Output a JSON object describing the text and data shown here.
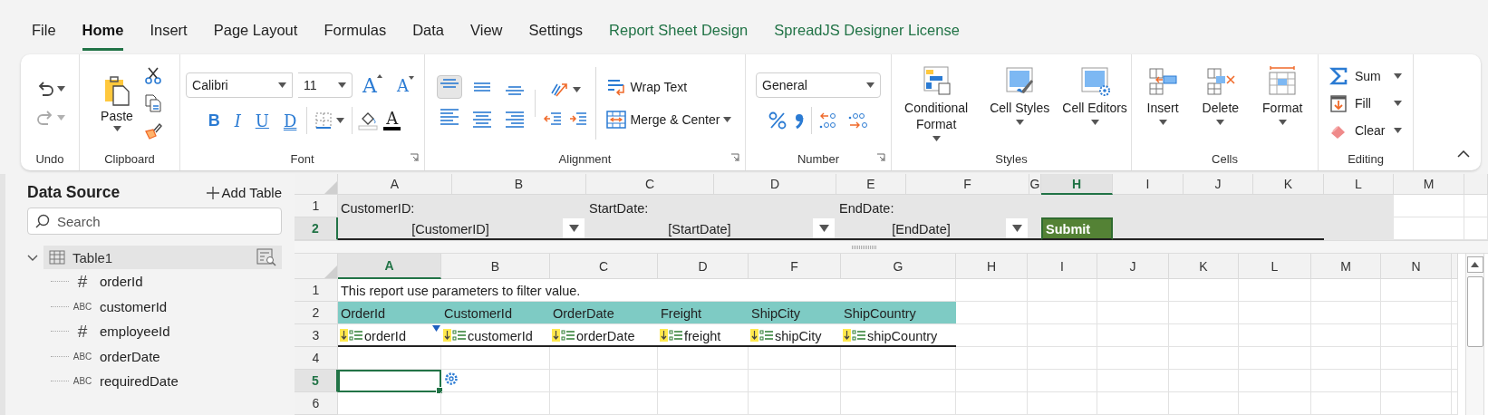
{
  "menu": [
    {
      "label": "File",
      "selected": false,
      "kind": "tab"
    },
    {
      "label": "Home",
      "selected": true,
      "kind": "tab"
    },
    {
      "label": "Insert",
      "selected": false,
      "kind": "tab"
    },
    {
      "label": "Page Layout",
      "selected": false,
      "kind": "tab"
    },
    {
      "label": "Formulas",
      "selected": false,
      "kind": "tab"
    },
    {
      "label": "Data",
      "selected": false,
      "kind": "tab"
    },
    {
      "label": "View",
      "selected": false,
      "kind": "tab"
    },
    {
      "label": "Settings",
      "selected": false,
      "kind": "tab"
    },
    {
      "label": "Report Sheet Design",
      "selected": false,
      "kind": "link"
    },
    {
      "label": "SpreadJS Designer License",
      "selected": false,
      "kind": "link"
    }
  ],
  "ribbon": {
    "undo": {
      "label": "Undo",
      "buttons": [
        {
          "disabled": false
        },
        {
          "disabled": true
        }
      ]
    },
    "clipboard": {
      "label": "Clipboard",
      "paste": "Paste"
    },
    "font": {
      "label": "Font",
      "name": "Calibri",
      "size": "11",
      "grow": "A",
      "shrink": "A",
      "styles": [
        "B",
        "I",
        "U",
        "D"
      ],
      "color_glyph": "A"
    },
    "alignment": {
      "label": "Alignment",
      "align": [
        {
          "selected": true
        },
        {
          "selected": false
        },
        {
          "selected": false
        },
        {
          "selected": false
        },
        {
          "selected": false
        },
        {
          "selected": false
        }
      ],
      "wrap": "Wrap Text",
      "merge": "Merge & Center"
    },
    "number": {
      "label": "Number",
      "format": "General"
    },
    "styles": {
      "label": "Styles",
      "buttons": [
        "Conditional Format",
        "Cell Styles",
        "Cell Editors"
      ]
    },
    "cells": {
      "label": "Cells",
      "buttons": [
        "Insert",
        "Delete",
        "Format"
      ]
    },
    "editing": {
      "label": "Editing",
      "buttons": [
        "Sum",
        "Fill",
        "Clear"
      ]
    }
  },
  "sidebar": {
    "title": "Data Source",
    "add_button": "Add Table",
    "search": {
      "placeholder": "Search"
    },
    "tree": [
      {
        "label": "Table1",
        "expanded": true,
        "selected": true,
        "children": [
          {
            "label": "orderId",
            "type_mark": "#"
          },
          {
            "label": "customerId",
            "type_mark": "ABC"
          },
          {
            "label": "employeeId",
            "type_mark": "#"
          },
          {
            "label": "orderDate",
            "type_mark": "ABC"
          },
          {
            "label": "requiredDate",
            "type_mark": "ABC"
          }
        ]
      }
    ]
  },
  "parameter_sheet": {
    "columns": [
      {
        "label": "A",
        "selected": false
      },
      {
        "label": "B",
        "selected": false
      },
      {
        "label": "C",
        "selected": false
      },
      {
        "label": "D",
        "selected": false
      },
      {
        "label": "E",
        "selected": false
      },
      {
        "label": "F",
        "selected": false
      },
      {
        "label": "G",
        "selected": false
      },
      {
        "label": "H",
        "selected": true
      },
      {
        "label": "I",
        "selected": false
      },
      {
        "label": "J",
        "selected": false
      },
      {
        "label": "K",
        "selected": false
      },
      {
        "label": "L",
        "selected": false
      },
      {
        "label": "M",
        "selected": false
      }
    ],
    "rows": [
      {
        "label": "1",
        "selected": false
      },
      {
        "label": "2",
        "selected": true
      }
    ],
    "parameters": [
      {
        "label": "CustomerID:",
        "value": "[CustomerID]"
      },
      {
        "label": "StartDate:",
        "value": "[StartDate]"
      },
      {
        "label": "EndDate:",
        "value": "[EndDate]"
      }
    ],
    "submit": "Submit"
  },
  "report_sheet": {
    "columns": [
      {
        "label": "A",
        "selected": true
      },
      {
        "label": "B",
        "selected": false
      },
      {
        "label": "C",
        "selected": false
      },
      {
        "label": "D",
        "selected": false
      },
      {
        "label": "F",
        "selected": false
      },
      {
        "label": "G",
        "selected": false
      },
      {
        "label": "H",
        "selected": false
      },
      {
        "label": "I",
        "selected": false
      },
      {
        "label": "J",
        "selected": false
      },
      {
        "label": "K",
        "selected": false
      },
      {
        "label": "L",
        "selected": false
      },
      {
        "label": "M",
        "selected": false
      },
      {
        "label": "N",
        "selected": false
      }
    ],
    "rows": [
      {
        "label": "1",
        "selected": false
      },
      {
        "label": "2",
        "selected": false
      },
      {
        "label": "3",
        "selected": false
      },
      {
        "label": "4",
        "selected": false
      },
      {
        "label": "5",
        "selected": true
      },
      {
        "label": "6",
        "selected": false
      }
    ],
    "note": "This report use parameters to filter value.",
    "headers": [
      "OrderId",
      "CustomerId",
      "OrderDate",
      "Freight",
      "ShipCity",
      "ShipCountry"
    ],
    "fields": [
      {
        "name": "orderId",
        "filtered": true
      },
      {
        "name": "customerId",
        "filtered": false
      },
      {
        "name": "orderDate",
        "filtered": false
      },
      {
        "name": "freight",
        "filtered": false
      },
      {
        "name": "shipCity",
        "filtered": false
      },
      {
        "name": "shipCountry",
        "filtered": false
      }
    ]
  }
}
